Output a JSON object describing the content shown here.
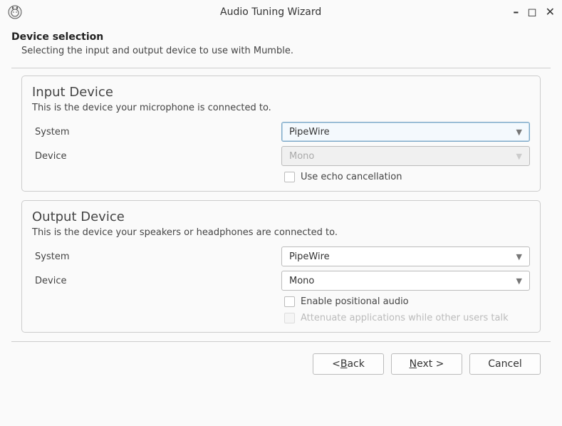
{
  "window": {
    "title": "Audio Tuning Wizard"
  },
  "header": {
    "heading": "Device selection",
    "subheading": "Selecting the input and output device to use with Mumble."
  },
  "input_group": {
    "title": "Input Device",
    "subtitle": "This is the device your microphone is connected to.",
    "system_label": "System",
    "system_value": "PipeWire",
    "device_label": "Device",
    "device_value": "Mono",
    "echo_label": "Use echo cancellation"
  },
  "output_group": {
    "title": "Output Device",
    "subtitle": "This is the device your speakers or headphones are connected to.",
    "system_label": "System",
    "system_value": "PipeWire",
    "device_label": "Device",
    "device_value": "Mono",
    "positional_label": "Enable positional audio",
    "attenuate_label": "Attenuate applications while other users talk"
  },
  "buttons": {
    "back": "< Back",
    "next": "Next >",
    "cancel": "Cancel",
    "back_pre": "< ",
    "back_u": "B",
    "back_post": "ack",
    "next_u": "N",
    "next_post": "ext >"
  }
}
